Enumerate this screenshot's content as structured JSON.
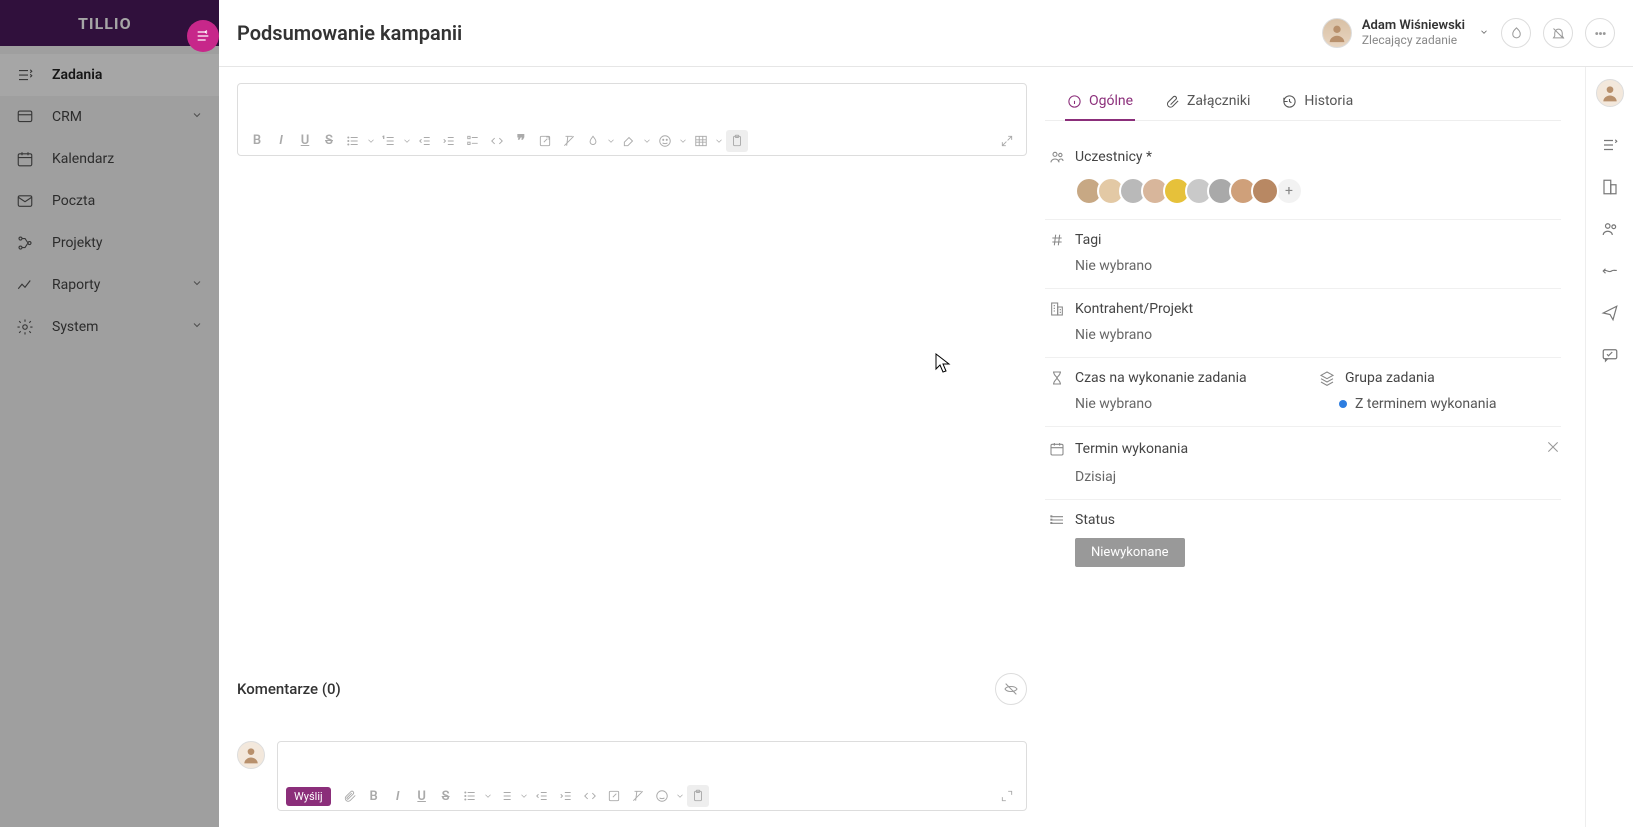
{
  "brand": "TILLIO",
  "sidebar": {
    "items": [
      {
        "label": "Zadania",
        "icon": "tasks",
        "active": true
      },
      {
        "label": "CRM",
        "icon": "crm",
        "chevron": true
      },
      {
        "label": "Kalendarz",
        "icon": "calendar"
      },
      {
        "label": "Poczta",
        "icon": "mail"
      },
      {
        "label": "Projekty",
        "icon": "projects"
      },
      {
        "label": "Raporty",
        "icon": "reports",
        "chevron": true
      },
      {
        "label": "System",
        "icon": "system",
        "chevron": true
      }
    ]
  },
  "header": {
    "title": "Podsumowanie kampanii",
    "owner_name": "Adam Wiśniewski",
    "owner_role": "Zlecający zadanie"
  },
  "tabs": [
    {
      "label": "Ogólne",
      "icon": "info",
      "active": true
    },
    {
      "label": "Załączniki",
      "icon": "attach"
    },
    {
      "label": "Historia",
      "icon": "history"
    }
  ],
  "fields": {
    "participants_label": "Uczestnicy *",
    "participants_count": 9,
    "participants_colors": [
      "#c7a884",
      "#e3c9a5",
      "#b9b9b9",
      "#d8b69b",
      "#e6c13a",
      "#c9c9c9",
      "#a9a9a9",
      "#cfa07a",
      "#b88863"
    ],
    "tags_label": "Tagi",
    "tags_value": "Nie wybrano",
    "contractor_label": "Kontrahent/Projekt",
    "contractor_value": "Nie wybrano",
    "time_label": "Czas na wykonanie zadania",
    "time_value": "Nie wybrano",
    "group_label": "Grupa zadania",
    "group_value": "Z terminem wykonania",
    "due_label": "Termin wykonania",
    "due_value": "Dzisiaj",
    "status_label": "Status",
    "status_value": "Niewykonane"
  },
  "comments": {
    "title": "Komentarze (0)",
    "send_label": "Wyślij"
  }
}
